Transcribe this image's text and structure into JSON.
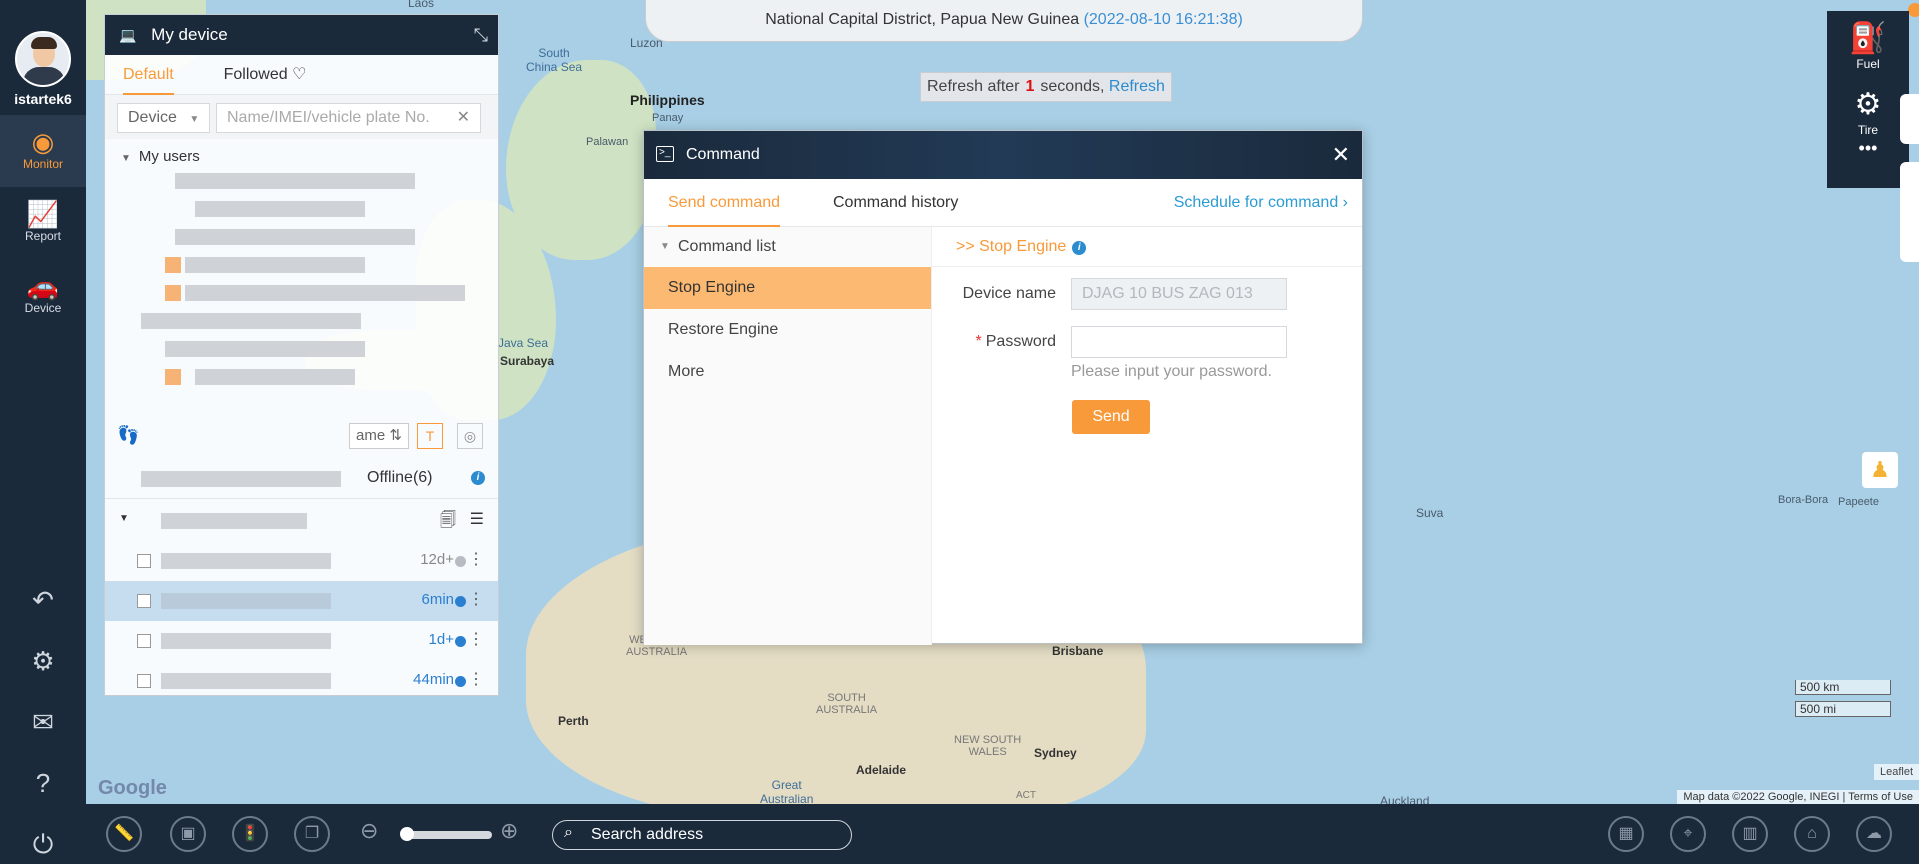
{
  "map": {
    "labels": {
      "laos": "Laos",
      "luzon": "Luzon",
      "south_china_sea": "South\nChina Sea",
      "philippines": "Philippines",
      "panay": "Panay",
      "palawan": "Palawan",
      "java_sea": "Java Sea",
      "surabaya": "Surabaya",
      "western_australia": "WESTERN\nAUSTRALIA",
      "south_australia": "SOUTH\nAUSTRALIA",
      "perth": "Perth",
      "adelaide": "Adelaide",
      "great_australian": "Great\nAustralian",
      "nsw": "NEW SOUTH\nWALES",
      "sydney": "Sydney",
      "brisbane": "Brisbane",
      "act": "ACT",
      "auckland": "Auckland",
      "suva": "Suva",
      "bora_bora": "Bora-Bora",
      "papeete": "Papeete"
    },
    "google": "Google",
    "attribution": "Map data ©2022 Google, INEGI",
    "terms": "Terms of Use",
    "leaflet": "Leaflet",
    "scale_km": "500 km",
    "scale_mi": "500 mi"
  },
  "address_bar": {
    "location": "National Capital District, Papua New Guinea",
    "timestamp": "(2022-08-10 16:21:38)"
  },
  "refresh": {
    "prefix": "Refresh after",
    "seconds": "1",
    "suffix": "seconds,",
    "link": "Refresh"
  },
  "sidebar": {
    "username": "istartek6",
    "items": [
      {
        "label": "Monitor",
        "icon": "monitor-icon"
      },
      {
        "label": "Report",
        "icon": "report-icon"
      },
      {
        "label": "Device",
        "icon": "device-icon"
      }
    ]
  },
  "right_tools": {
    "fuel": "Fuel",
    "tire": "Tire",
    "more": "•••"
  },
  "device_panel": {
    "title": "My device",
    "tabs": {
      "default": "Default",
      "followed": "Followed"
    },
    "search_type": "Device",
    "search_placeholder": "Name/IMEI/vehicle plate No.",
    "tree_root": "My users",
    "sort_label": "ame",
    "status_offline": "Offline(6)",
    "rows": [
      {
        "time": "12d+",
        "color": "#b7bcc2"
      },
      {
        "time": "6min",
        "color": "#2b7fd0"
      },
      {
        "time": "1d+",
        "color": "#2b7fd0"
      },
      {
        "time": "44min",
        "color": "#2b7fd0"
      }
    ]
  },
  "toolbar": {
    "search_placeholder": "Search address"
  },
  "dialog": {
    "title": "Command",
    "tabs": {
      "send": "Send command",
      "history": "Command history"
    },
    "schedule": "Schedule for command",
    "command_list_title": "Command list",
    "commands": [
      "Stop Engine",
      "Restore Engine",
      "More"
    ],
    "selected_title": ">> Stop Engine",
    "device_name_label": "Device name",
    "device_name_value": "DJAG 10 BUS ZAG 013",
    "password_label": "Password",
    "password_hint": "Please input your password.",
    "send_label": "Send"
  }
}
